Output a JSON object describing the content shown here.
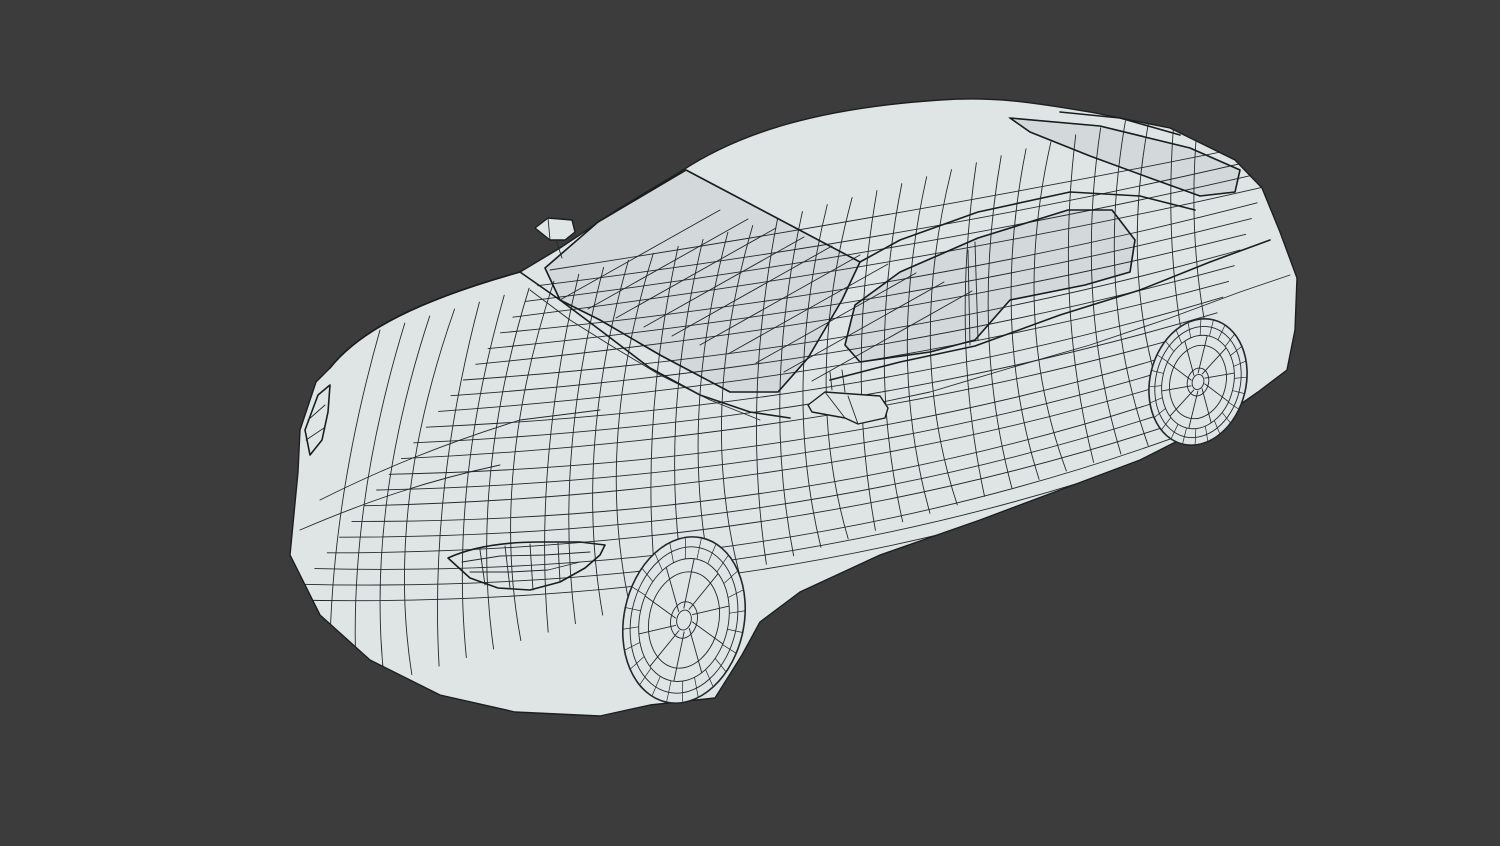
{
  "viewport": {
    "background_color": "#3c3c3c",
    "shaded_mode": "wireframe-on-shaded"
  },
  "model": {
    "kind": "sedan-car-mesh",
    "surface_color": "#dfe5e5",
    "wire_color": "#232729",
    "glass_color": "#d3d9da"
  }
}
